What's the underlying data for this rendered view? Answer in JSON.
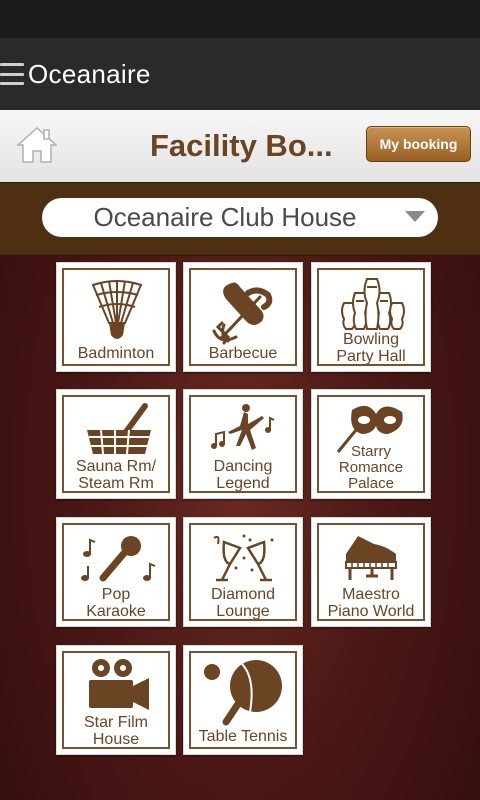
{
  "appbar": {
    "title": "Oceanaire"
  },
  "header": {
    "title": "Facility Bo...",
    "my_booking": "My booking"
  },
  "selector": {
    "value": "Oceanaire Club House"
  },
  "colors": {
    "brown": "#6b4423",
    "frame": "#76522f",
    "accent": "#b57a3a"
  },
  "facilities": [
    {
      "label": "Badminton",
      "icon": "shuttlecock-icon"
    },
    {
      "label": "Barbecue",
      "icon": "sausage-fork-icon"
    },
    {
      "label": "Bowling\nParty Hall",
      "icon": "bowling-pins-icon"
    },
    {
      "label": "Sauna Rm/\nSteam Rm",
      "icon": "sauna-bucket-icon"
    },
    {
      "label": "Dancing\nLegend",
      "icon": "dancer-icon"
    },
    {
      "label": "Starry\nRomance\nPalace",
      "icon": "mask-icon"
    },
    {
      "label": "Pop\nKaraoke",
      "icon": "microphone-icon"
    },
    {
      "label": "Diamond\nLounge",
      "icon": "champagne-icon"
    },
    {
      "label": "Maestro\nPiano World",
      "icon": "piano-icon"
    },
    {
      "label": "Star Film\nHouse",
      "icon": "film-camera-icon"
    },
    {
      "label": "Table Tennis",
      "icon": "ping-pong-icon"
    }
  ]
}
